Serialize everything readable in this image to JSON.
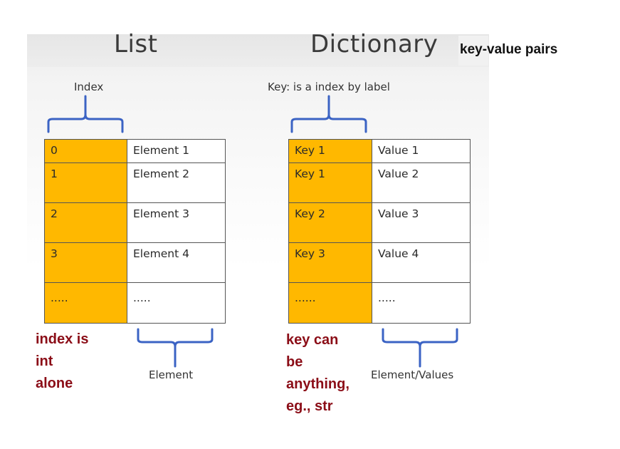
{
  "list": {
    "title": "List",
    "index_label": "Index",
    "element_label": "Element",
    "rows": [
      {
        "key": "0",
        "value": "Element  1"
      },
      {
        "key": "1",
        "value": "Element  2"
      },
      {
        "key": "2",
        "value": "Element  3"
      },
      {
        "key": "3",
        "value": "Element  4"
      },
      {
        "key": ".....",
        "value": "....."
      }
    ],
    "note": [
      "index is",
      "int",
      "alone"
    ]
  },
  "dictionary": {
    "title": "Dictionary",
    "key_label": "Key: is a index by label",
    "values_label": "Element/Values",
    "rows": [
      {
        "key": "Key 1",
        "value": "Value  1"
      },
      {
        "key": "Key 1",
        "value": "Value  2"
      },
      {
        "key": "Key 2",
        "value": "Value 3"
      },
      {
        "key": "Key 3",
        "value": "Value  4"
      },
      {
        "key": "......",
        "value": "....."
      }
    ],
    "note": [
      "key can",
      "be",
      "anything,",
      "eg., str"
    ]
  },
  "side_note": "key-value pairs",
  "colors": {
    "key_cell": "#ffb800",
    "note_text": "#8b0d17",
    "brace": "#3b63c4"
  }
}
